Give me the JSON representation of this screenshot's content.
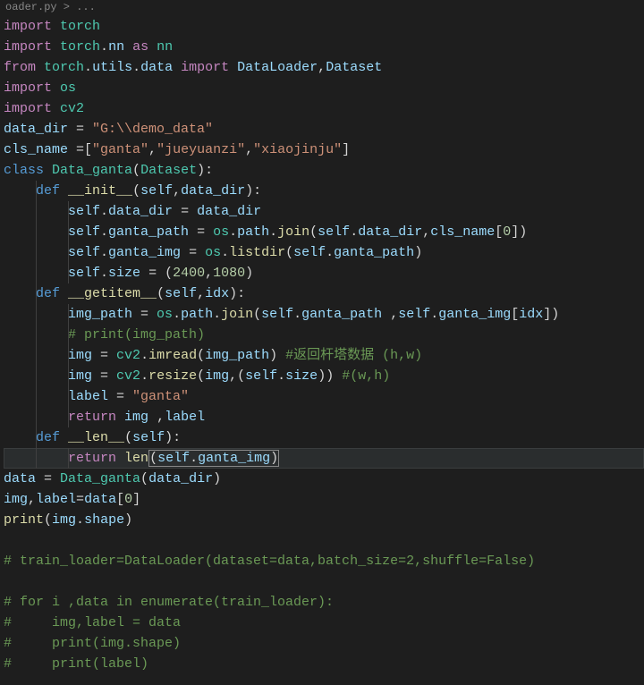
{
  "breadcrumb": "oader.py > ...",
  "l1": {
    "imp": "import",
    "mod": "torch"
  },
  "l2": {
    "imp": "import",
    "mod": "torch",
    "nn": "nn",
    "as": "as",
    "al": "nn"
  },
  "l3": {
    "from": "from",
    "mod": "torch",
    "utils": "utils",
    "data": "data",
    "imp": "import",
    "dl": "DataLoader",
    "ds": "Dataset"
  },
  "l4": {
    "imp": "import",
    "mod": "os"
  },
  "l5": {
    "imp": "import",
    "mod": "cv2"
  },
  "l6": {
    "var": "data_dir",
    "eq": " = ",
    "str": "\"G:\\\\demo_data\""
  },
  "l7": {
    "var": "cls_name",
    "eq": " =[",
    "s1": "\"ganta\"",
    "c1": ",",
    "s2": "\"jueyuanzi\"",
    "c2": ",",
    "s3": "\"xiaojinju\"",
    "end": "]"
  },
  "l8": {
    "cls": "class",
    "name": "Data_ganta",
    "open": "(",
    "p": "Dataset",
    "close": "):"
  },
  "l9": {
    "def": "def",
    "name": "__init__",
    "open": "(",
    "self": "self",
    "c": ",",
    "p1": "data_dir",
    "close": "):"
  },
  "l10": {
    "self": "self",
    "dot": ".",
    "prop": "data_dir",
    "eq": " = ",
    "rhs": "data_dir"
  },
  "l11": {
    "self": "self",
    "dot": ".",
    "prop": "ganta_path",
    "eq": " = ",
    "os": "os",
    "d2": ".",
    "path": "path",
    "d3": ".",
    "join": "join",
    "open": "(",
    "self2": "self",
    "d4": ".",
    "dd": "data_dir",
    "c": ",",
    "cls": "cls_name",
    "open2": "[",
    "zero": "0",
    "close2": "])"
  },
  "l12": {
    "self": "self",
    "dot": ".",
    "prop": "ganta_img",
    "eq": " = ",
    "os": "os",
    "d2": ".",
    "listdir": "listdir",
    "open": "(",
    "self2": "self",
    "d3": ".",
    "gp": "ganta_path",
    "close": ")"
  },
  "l13": {
    "self": "self",
    "dot": ".",
    "prop": "size",
    "eq": " = (",
    "n1": "2400",
    "c": ",",
    "n2": "1080",
    "close": ")"
  },
  "l14": {
    "def": "def",
    "name": "__getitem__",
    "open": "(",
    "self": "self",
    "c": ",",
    "p1": "idx",
    "close": "):"
  },
  "l15": {
    "var": "img_path",
    "eq": " = ",
    "os": "os",
    "d": ".",
    "path": "path",
    "d2": ".",
    "join": "join",
    "open": "(",
    "self": "self",
    "d3": ".",
    "gp": "ganta_path",
    "sp": " ,",
    "self2": "self",
    "d4": ".",
    "gi": "ganta_img",
    "open2": "[",
    "idx": "idx",
    "close": "])"
  },
  "l16": {
    "cmt": "# print(img_path)"
  },
  "l17": {
    "var": "img",
    "eq": " = ",
    "cv2": "cv2",
    "d": ".",
    "imread": "imread",
    "open": "(",
    "p": "img_path",
    "close": ") ",
    "cmt": "#返回杆塔数据 (h,w)"
  },
  "l18": {
    "var": "img",
    "eq": " = ",
    "cv2": "cv2",
    "d": ".",
    "resize": "resize",
    "open": "(",
    "img": "img",
    "c": ",(",
    "self": "self",
    "d2": ".",
    "size": "size",
    "close": ")) ",
    "cmt": "#(w,h)"
  },
  "l19": {
    "var": "label",
    "eq": " = ",
    "str": "\"ganta\""
  },
  "l20": {
    "ret": "return",
    "sp": " ",
    "img": "img",
    "sp2": " ,",
    "label": "label"
  },
  "l21": {
    "def": "def",
    "name": "__len__",
    "open": "(",
    "self": "self",
    "close": "):"
  },
  "l22": {
    "ret": "return",
    "sp": " ",
    "len": "len",
    "open": "(",
    "self": "self",
    "dot": ".",
    "gi": "ganta_img",
    "close": ")"
  },
  "l23": {
    "var": "data",
    "eq": " = ",
    "cls": "Data_ganta",
    "open": "(",
    "p": "data_dir",
    "close": ")"
  },
  "l24": {
    "lhs": "img",
    "c": ",",
    "lhs2": "label",
    "eq": "=",
    "rhs": "data",
    "open": "[",
    "zero": "0",
    "close": "]"
  },
  "l25": {
    "print": "print",
    "open": "(",
    "v": "img",
    "dot": ".",
    "shape": "shape",
    "close": ")"
  },
  "l27": {
    "cmt": "# train_loader=DataLoader(dataset=data,batch_size=2,shuffle=False)"
  },
  "l29": {
    "cmt": "# for i ,data in enumerate(train_loader):"
  },
  "l30": {
    "cmt": "#     img,label = data"
  },
  "l31": {
    "cmt": "#     print(img.shape)"
  },
  "l32": {
    "cmt": "#     print(label)"
  }
}
